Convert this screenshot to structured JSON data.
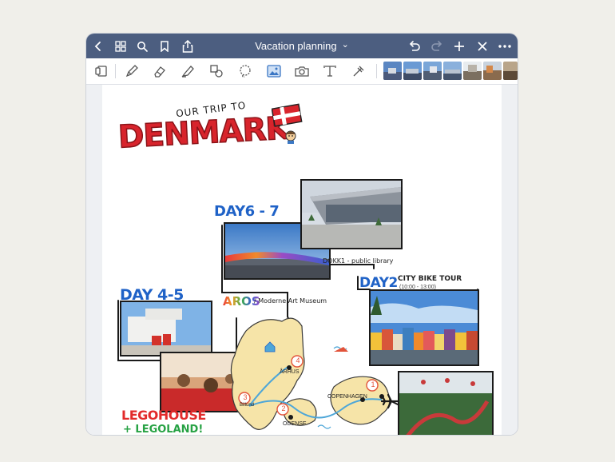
{
  "app": {
    "document_title": "Vacation planning",
    "title_chevron": "⌄"
  },
  "titlebar_icons": [
    "back-icon",
    "grid-icon",
    "search-icon",
    "bookmark-icon",
    "share-icon",
    "undo-icon",
    "redo-icon",
    "add-icon",
    "close-icon",
    "more-icon"
  ],
  "toolbar_tools": [
    "page-view-icon",
    "pen-icon",
    "eraser-icon",
    "highlighter-icon",
    "shapes-icon",
    "lasso-icon",
    "image-icon",
    "camera-icon",
    "text-icon",
    "elements-icon"
  ],
  "note": {
    "header_small": "OUR TRIP TO",
    "header_big": "DENMARK",
    "day67": "DAY6 - 7",
    "day45": "DAY 4-5",
    "day2": "DAY2",
    "city_bike": "CITY BIKE TOUR",
    "city_bike_sub": "(10:00 - 13:00)",
    "dokk1": "DOKK1 - public library",
    "aros": "AROS",
    "aros_sub": "/ Moderne Art Museum",
    "legohouse": "LEGOHOUSE",
    "legoland": "+ LEGOLAND!",
    "map": {
      "aarhus": "ÅRHUS",
      "odense": "ODENSE",
      "copenhagen": "COPENHAGEN",
      "billund": "Billund",
      "stop1": "1",
      "stop2": "2",
      "stop3": "3",
      "stop4": "4"
    }
  },
  "colors": {
    "titlebar": "#4c5e80",
    "day_blue": "#1f62c7",
    "denmark_red": "#d8242c",
    "legohouse_red": "#e22b2b",
    "legoland_green": "#27a244",
    "map_land": "#f6e4a8",
    "map_water": "#4da6d8",
    "route_marker": "#e2533a"
  }
}
